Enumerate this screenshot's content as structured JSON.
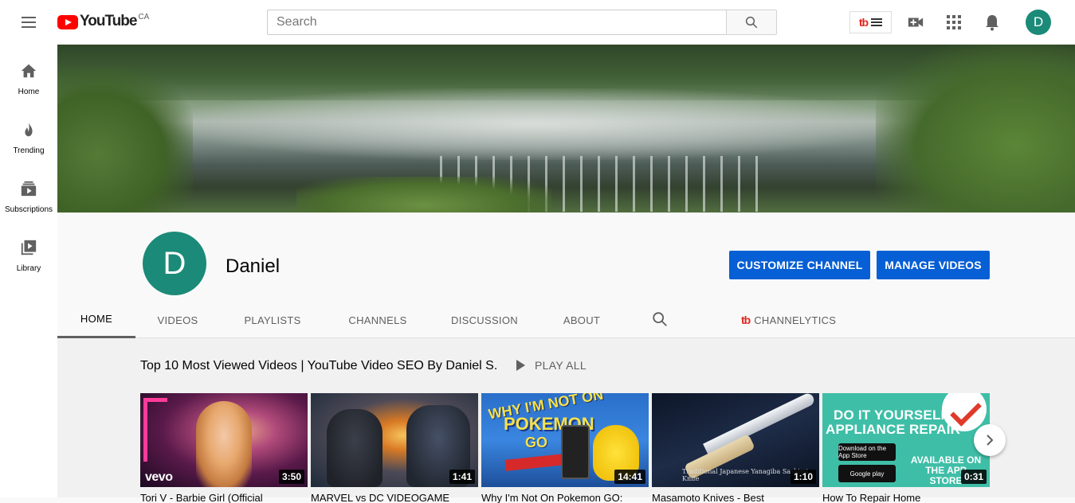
{
  "header": {
    "logo_text": "YouTube",
    "region": "CA",
    "search_placeholder": "Search",
    "avatar_letter": "D",
    "tb_mark": "tb"
  },
  "sidebar": {
    "items": [
      {
        "label": "Home",
        "icon": "home-icon"
      },
      {
        "label": "Trending",
        "icon": "trending-icon"
      },
      {
        "label": "Subscriptions",
        "icon": "subscriptions-icon"
      },
      {
        "label": "Library",
        "icon": "library-icon"
      }
    ]
  },
  "channel": {
    "avatar_letter": "D",
    "name": "Daniel",
    "customize_label": "CUSTOMIZE CHANNEL",
    "manage_label": "MANAGE VIDEOS"
  },
  "tabs": {
    "items": [
      "HOME",
      "VIDEOS",
      "PLAYLISTS",
      "CHANNELS",
      "DISCUSSION",
      "ABOUT"
    ],
    "active": "HOME",
    "channelytics_label": "CHANNELYTICS",
    "channelytics_mark": "tb"
  },
  "shelf": {
    "title": "Top 10 Most Viewed Videos | YouTube Video SEO By Daniel S.",
    "play_all_label": "PLAY ALL",
    "videos": [
      {
        "duration": "3:50",
        "title": "Tori V - Barbie Girl (Official",
        "overlay": "vevo"
      },
      {
        "duration": "1:41",
        "title": "MARVEL vs DC VIDEOGAME"
      },
      {
        "duration": "14:41",
        "title": "Why I'm Not On Pokemon GO:",
        "overlay1": "WHY I'M NOT ON",
        "overlay2": "POKEMON",
        "overlay3": "GO"
      },
      {
        "duration": "1:10",
        "title": "Masamoto Knives - Best",
        "overlay": "Traditional Japanese Yanagiba Sashimi Knife"
      },
      {
        "duration": "0:31",
        "title": "How To Repair Home",
        "overlay1": "DO IT YOURSELF",
        "overlay2": "APPLIANCE REPAIR",
        "store1": "Download on the App Store",
        "store2": "Google play",
        "avail": "AVAILABLE ON THE APP STORE"
      }
    ]
  },
  "colors": {
    "brand_red": "#ff0000",
    "accent_blue": "#065fd4",
    "avatar_teal": "#1b8a78"
  }
}
